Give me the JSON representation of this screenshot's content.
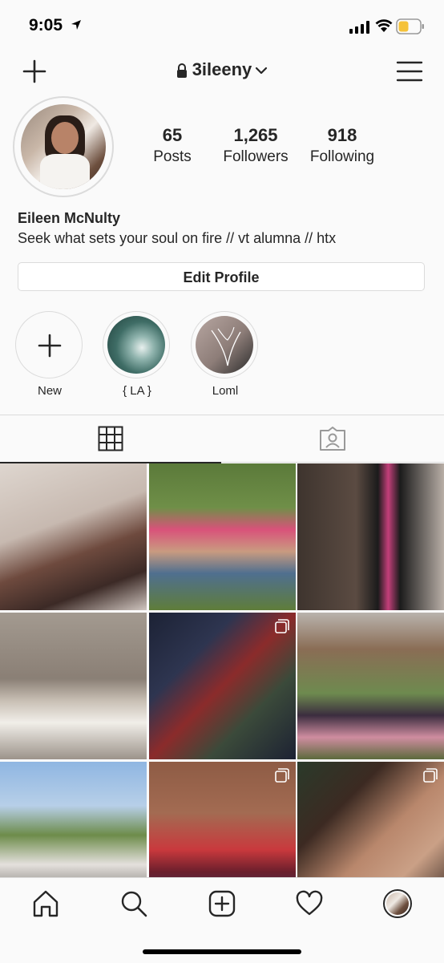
{
  "status_bar": {
    "time": "9:05",
    "battery_color": "#f5c23a"
  },
  "header": {
    "username": "3ileeny"
  },
  "profile": {
    "stats": [
      {
        "value": "65",
        "label": "Posts"
      },
      {
        "value": "1,265",
        "label": "Followers"
      },
      {
        "value": "918",
        "label": "Following"
      }
    ],
    "full_name": "Eileen McNulty",
    "bio": "Seek what sets your soul on fire // vt alumna // htx",
    "edit_button": "Edit Profile"
  },
  "highlights": [
    {
      "label": "New",
      "icon": "plus-icon"
    },
    {
      "label": "{ LA }"
    },
    {
      "label": "Loml"
    }
  ],
  "tabs": [
    {
      "name": "grid",
      "icon": "grid-icon",
      "active": true
    },
    {
      "name": "tagged",
      "icon": "tagged-person-icon",
      "active": false
    }
  ],
  "grid_posts": [
    {
      "multiple": false
    },
    {
      "multiple": false
    },
    {
      "multiple": false
    },
    {
      "multiple": false
    },
    {
      "multiple": true
    },
    {
      "multiple": false
    },
    {
      "multiple": false
    },
    {
      "multiple": true
    },
    {
      "multiple": true
    }
  ],
  "bottom_nav": [
    {
      "name": "home",
      "icon": "home-icon"
    },
    {
      "name": "search",
      "icon": "search-icon"
    },
    {
      "name": "add",
      "icon": "add-post-icon"
    },
    {
      "name": "activity",
      "icon": "heart-icon"
    },
    {
      "name": "profile",
      "icon": "profile-avatar"
    }
  ]
}
